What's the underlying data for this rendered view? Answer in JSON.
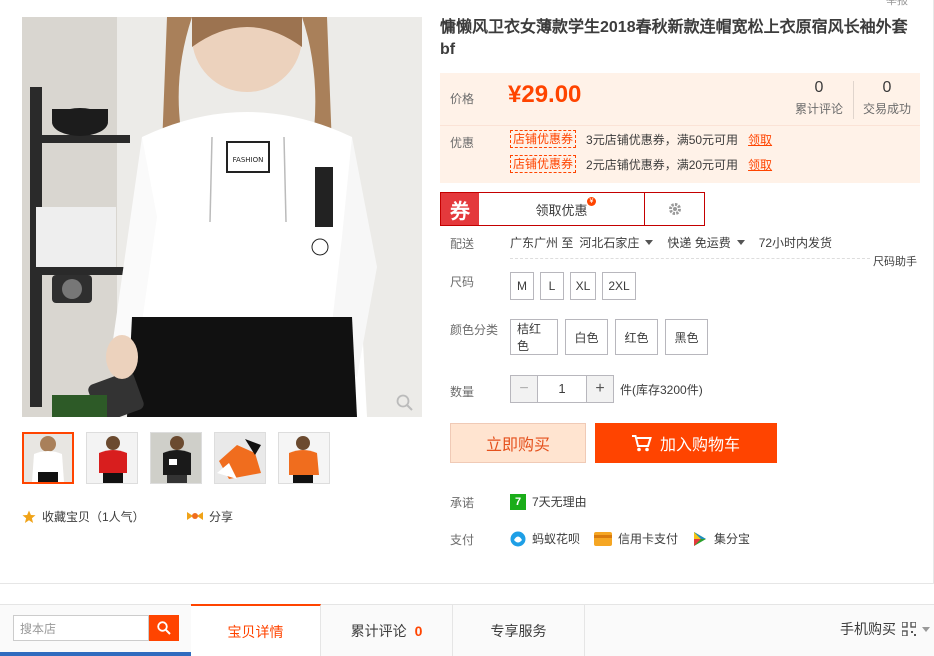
{
  "header": {
    "report_label": "举报"
  },
  "product": {
    "title": "慵懒风卫衣女薄款学生2018春秋新款连帽宽松上衣原宿风长袖外套bf",
    "price_label": "价格",
    "price": "¥29.00",
    "stats": [
      {
        "value": "0",
        "label": "累计评论"
      },
      {
        "value": "0",
        "label": "交易成功"
      }
    ],
    "promo_label": "优惠",
    "promos": [
      {
        "tag": "店铺优惠券",
        "text": "3元店铺优惠券，满50元可用",
        "link": "领取"
      },
      {
        "tag": "店铺优惠券",
        "text": "2元店铺优惠券，满20元可用",
        "link": "领取"
      }
    ],
    "coupon": {
      "tag": "券",
      "get_label": "领取优惠"
    }
  },
  "shipping": {
    "label": "配送",
    "from": "广东广州 至",
    "to": "河北石家庄",
    "method": "快递 免运费",
    "dispatch": "72小时内发货",
    "size_helper": "尺码助手"
  },
  "options": {
    "size_label": "尺码",
    "sizes": [
      "M",
      "L",
      "XL",
      "2XL"
    ],
    "color_label": "颜色分类",
    "colors": [
      "桔红色",
      "白色",
      "红色",
      "黑色"
    ]
  },
  "quantity": {
    "label": "数量",
    "value": "1",
    "minus": "−",
    "plus": "+",
    "stock": "件(库存3200件)"
  },
  "actions": {
    "buy_now": "立即购买",
    "add_cart": "加入购物车"
  },
  "promise": {
    "label": "承诺",
    "badge": "7",
    "text": "7天无理由"
  },
  "payment": {
    "label": "支付",
    "methods": [
      "蚂蚁花呗",
      "信用卡支付",
      "集分宝"
    ]
  },
  "social": {
    "favorite": "收藏宝贝（1人气）",
    "share": "分享"
  },
  "bottom": {
    "search_placeholder": "搜本店",
    "tabs": [
      {
        "label": "宝贝详情"
      },
      {
        "label": "累计评论",
        "count": "0"
      },
      {
        "label": "专享服务"
      }
    ],
    "mobile_buy": "手机购买"
  },
  "colors": {
    "accent": "#ff4400",
    "price_bg": "#fff2e8",
    "coupon_red": "#e4393c"
  }
}
